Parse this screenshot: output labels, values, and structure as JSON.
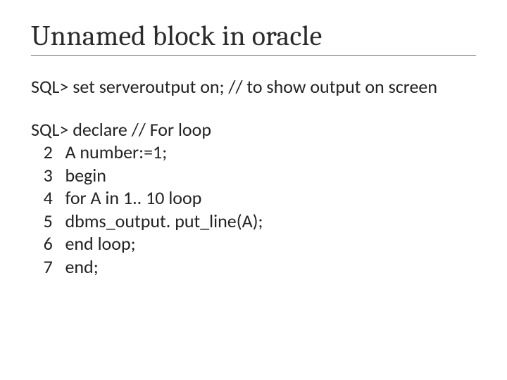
{
  "title": "Unnamed block in oracle",
  "line1": "SQL>  set serveroutput on;       // to show output on screen",
  "decl_head": "SQL>  declare                                 // For loop",
  "code": {
    "l2": "   2   A number:=1;",
    "l3": "   3   begin",
    "l4": "   4   for A in 1.. 10 loop",
    "l5": "   5   dbms_output. put_line(A);",
    "l6": "   6   end loop;",
    "l7": "   7   end;"
  }
}
